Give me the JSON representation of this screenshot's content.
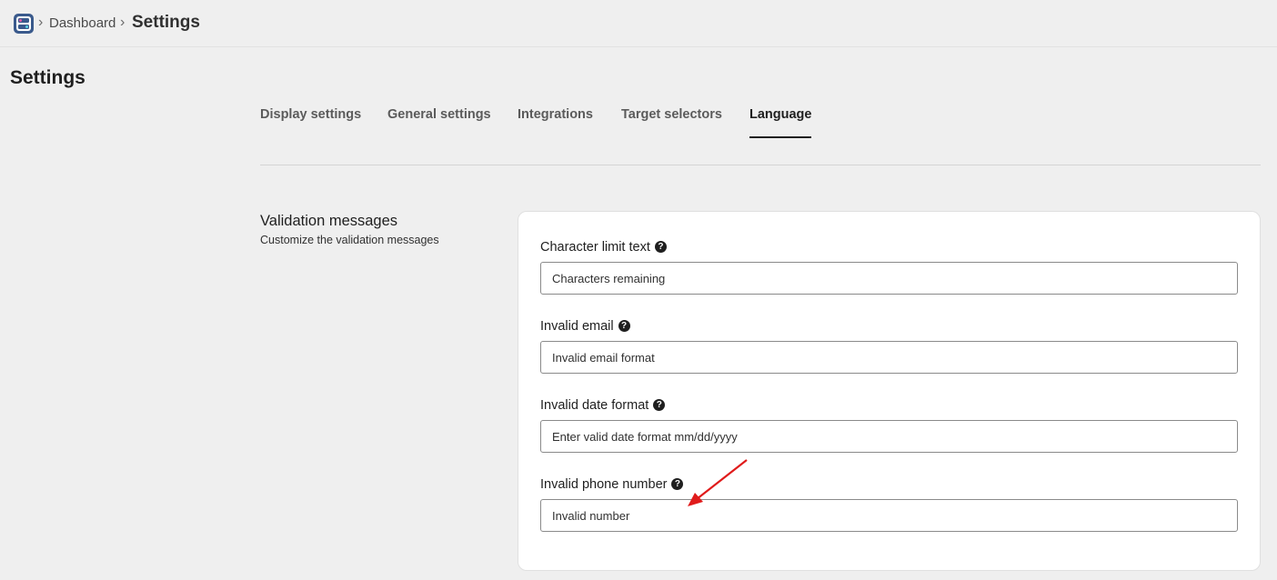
{
  "breadcrumb": {
    "parent": "Dashboard",
    "current": "Settings",
    "separator": "›"
  },
  "page": {
    "title": "Settings"
  },
  "tabs": [
    {
      "label": "Display settings",
      "active": false
    },
    {
      "label": "General settings",
      "active": false
    },
    {
      "label": "Integrations",
      "active": false
    },
    {
      "label": "Target selectors",
      "active": false
    },
    {
      "label": "Language",
      "active": true
    }
  ],
  "section": {
    "title": "Validation messages",
    "subtitle": "Customize the validation messages"
  },
  "fields": [
    {
      "label": "Character limit text",
      "value": "Characters remaining"
    },
    {
      "label": "Invalid email",
      "value": "Invalid email format"
    },
    {
      "label": "Invalid date format",
      "value": "Enter valid date format mm/dd/yyyy"
    },
    {
      "label": "Invalid phone number",
      "value": "Invalid number"
    }
  ],
  "icons": {
    "help": "question-circle-icon",
    "app": "app-logo-icon"
  },
  "colors": {
    "annotation_arrow": "#e01b1b",
    "active_tab_underline": "#1f1f1f"
  }
}
